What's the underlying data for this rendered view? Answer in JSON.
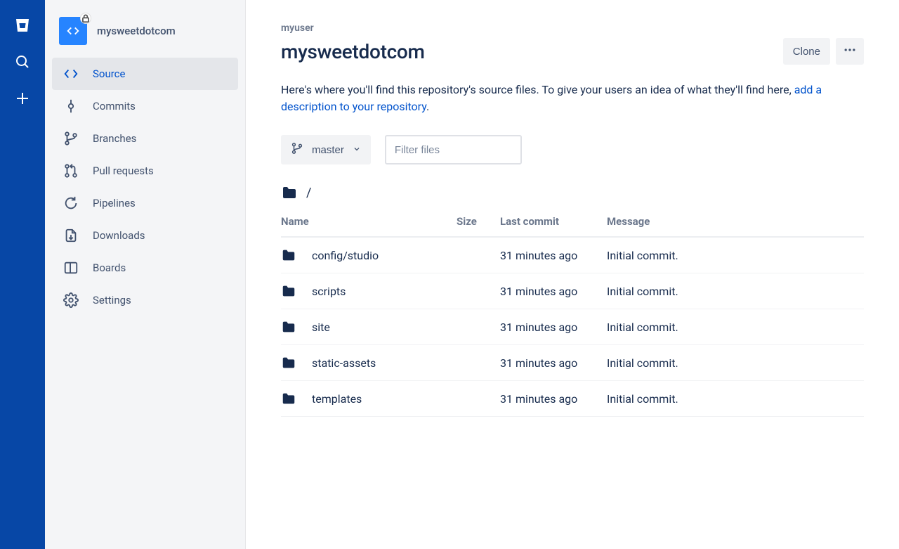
{
  "breadcrumb": "myuser",
  "repo_name": "mysweetdotcom",
  "sidebar": {
    "repo_label": "mysweetdotcom",
    "items": [
      {
        "label": "Source"
      },
      {
        "label": "Commits"
      },
      {
        "label": "Branches"
      },
      {
        "label": "Pull requests"
      },
      {
        "label": "Pipelines"
      },
      {
        "label": "Downloads"
      },
      {
        "label": "Boards"
      },
      {
        "label": "Settings"
      }
    ]
  },
  "actions": {
    "clone": "Clone"
  },
  "description_text": "Here's where you'll find this repository's source files. To give your users an idea of what they'll find here, ",
  "description_link": "add a description to your repository",
  "description_suffix": ".",
  "branch": {
    "label": "master"
  },
  "filter_placeholder": "Filter files",
  "path_label": "/",
  "table": {
    "headers": {
      "name": "Name",
      "size": "Size",
      "last": "Last commit",
      "message": "Message"
    },
    "rows": [
      {
        "name": "config/studio",
        "size": "",
        "last": "31 minutes ago",
        "message": "Initial commit."
      },
      {
        "name": "scripts",
        "size": "",
        "last": "31 minutes ago",
        "message": "Initial commit."
      },
      {
        "name": "site",
        "size": "",
        "last": "31 minutes ago",
        "message": "Initial commit."
      },
      {
        "name": "static-assets",
        "size": "",
        "last": "31 minutes ago",
        "message": "Initial commit."
      },
      {
        "name": "templates",
        "size": "",
        "last": "31 minutes ago",
        "message": "Initial commit."
      }
    ]
  }
}
